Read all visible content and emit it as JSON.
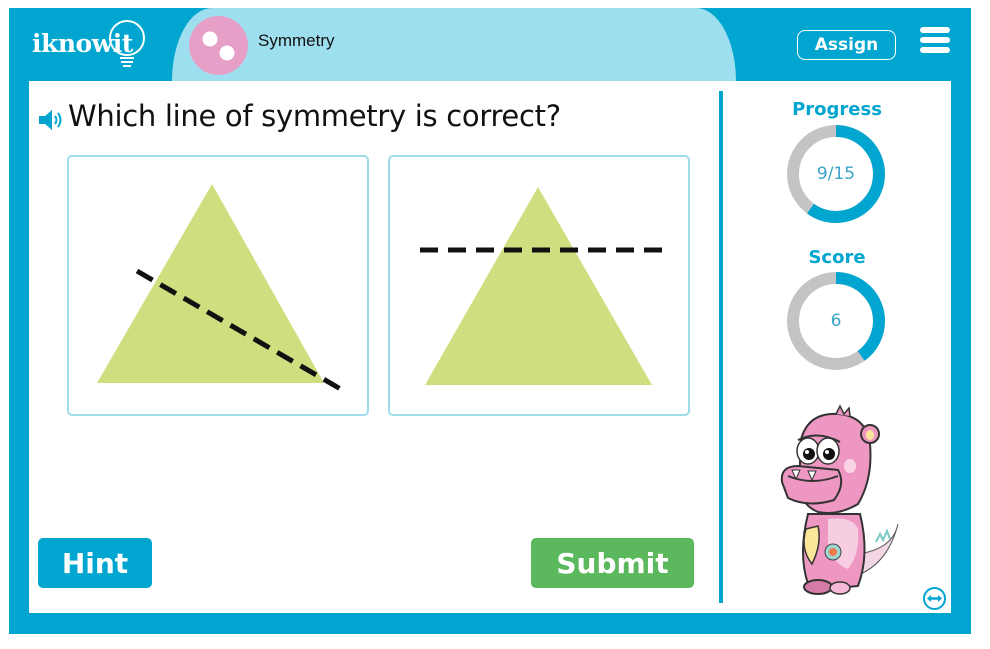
{
  "header": {
    "logo_text": "iknowit",
    "topic_title": "Symmetry",
    "assign_label": "Assign",
    "menu_icon": "hamburger-menu-icon"
  },
  "question": {
    "speaker_icon": "speaker-icon",
    "text": "Which line of symmetry is correct?",
    "choices": [
      {
        "id": "a",
        "shape": "triangle",
        "line": "diagonal-dashed",
        "fill": "#cddf7e"
      },
      {
        "id": "b",
        "shape": "triangle",
        "line": "horizontal-dashed",
        "fill": "#cddf7e"
      }
    ]
  },
  "actions": {
    "hint_label": "Hint",
    "submit_label": "Submit"
  },
  "sidebar": {
    "progress": {
      "label": "Progress",
      "value_text": "9/15",
      "current": 9,
      "total": 15
    },
    "score": {
      "label": "Score",
      "value_text": "6",
      "fraction": 0.4
    },
    "mascot": "pink-monster-mascot",
    "expand_icon": "expand-horizontal-icon"
  },
  "colors": {
    "primary": "#00a6cf",
    "topic_bg": "#9ddfee",
    "topic_badge": "#e6a0c8",
    "submit": "#5cb85c",
    "ring_track": "#c4c4c4",
    "shape_fill": "#cddf7e"
  }
}
